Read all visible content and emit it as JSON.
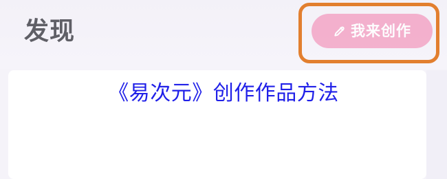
{
  "header": {
    "title": "发现",
    "create_button_label": "我来创作"
  },
  "main": {
    "article_title": "《易次元》创作作品方法"
  },
  "colors": {
    "accent": "#f3a8c8",
    "highlight_border": "#e27f2f",
    "title_text": "#2020e8",
    "header_text": "#5f5f66"
  },
  "icons": {
    "create_button_icon": "pencil-icon"
  }
}
